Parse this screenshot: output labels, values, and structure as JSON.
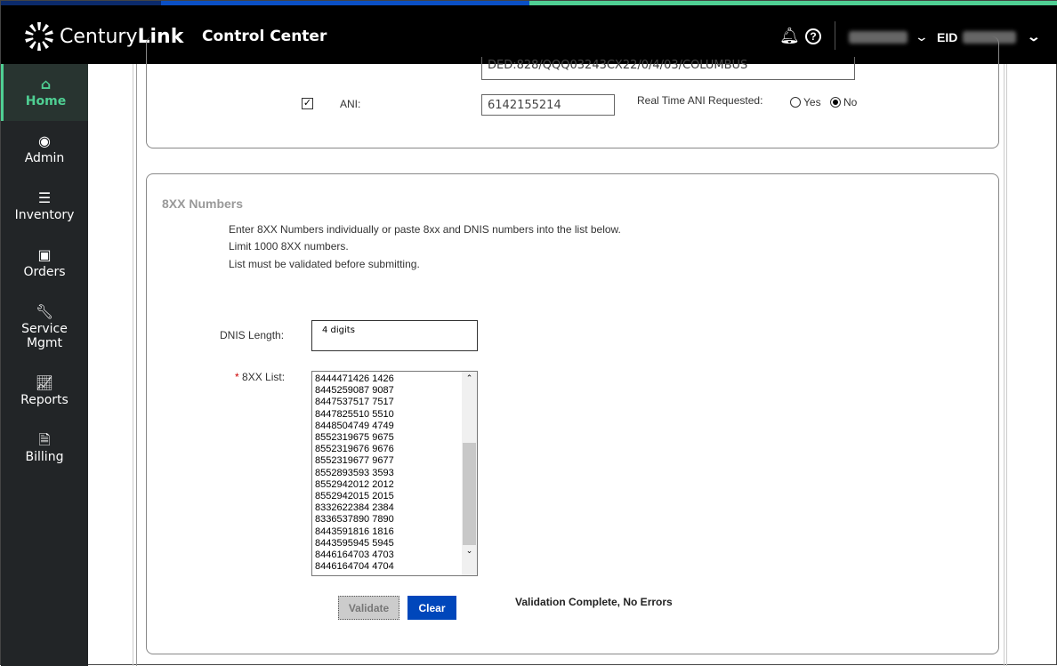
{
  "header": {
    "brand_light": "Century",
    "brand_bold": "Link",
    "title": "Control Center",
    "eid_label": "EID",
    "colors": {
      "stripe_navy": "#0b2a6b",
      "stripe_blue": "#0a4fc4",
      "stripe_green": "#4fcf93"
    }
  },
  "sidebar": {
    "items": [
      {
        "label": "Home",
        "icon": "home-icon"
      },
      {
        "label": "Admin",
        "icon": "user-icon"
      },
      {
        "label": "Inventory",
        "icon": "list-icon"
      },
      {
        "label": "Orders",
        "icon": "inbox-icon"
      },
      {
        "label": "Service Mgmt",
        "icon": "wrench-icon"
      },
      {
        "label": "Reports",
        "icon": "chart-icon"
      },
      {
        "label": "Billing",
        "icon": "invoice-icon"
      }
    ]
  },
  "top_panel": {
    "circuit_value": "DED:828/QQQ03243CX22/0/4/03/COLUMBUS",
    "ani_label": "ANI:",
    "ani_checked": true,
    "ani_value": "6142155214",
    "realtime_label": "Real Time ANI Requested:",
    "yes_label": "Yes",
    "no_label": "No",
    "selected": "No"
  },
  "numbers_panel": {
    "title": "8XX Numbers",
    "instructions": [
      "Enter 8XX Numbers individually or paste 8xx and DNIS numbers into the list below.",
      "Limit 1000 8XX numbers.",
      "List must be validated before submitting."
    ],
    "dnis_label": "DNIS Length:",
    "dnis_value": "4 digits",
    "required_mark": "*",
    "list_label": "8XX List:",
    "list": [
      "8444471426 1426",
      "8445259087 9087",
      "8447537517 7517",
      "8447825510 5510",
      "8448504749 4749",
      "8552319675 9675",
      "8552319676 9676",
      "8552319677 9677",
      "8552893593 3593",
      "8552942012 2012",
      "8552942015 2015",
      "8332622384 2384",
      "8336537890 7890",
      "8443591816 1816",
      "8443595945 5945",
      "8446164703 4703",
      "8446164704 4704"
    ],
    "validate_label": "Validate",
    "clear_label": "Clear",
    "status": "Validation Complete, No Errors"
  }
}
